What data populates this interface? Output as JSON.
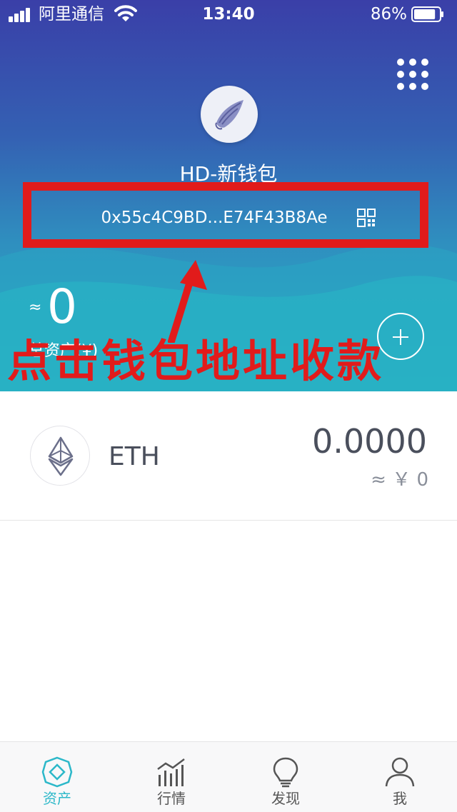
{
  "status_bar": {
    "carrier": "阿里通信",
    "time": "13:40",
    "battery": "86%",
    "battery_level": 0.86
  },
  "wallet": {
    "name": "HD-新钱包",
    "address": "0x55c4C9BD...E74F43B8Ae",
    "avatar_icon": "shell-icon"
  },
  "assets": {
    "approx_symbol": "≈",
    "total_value": "0",
    "total_label": "总资产(¥)"
  },
  "annotation": {
    "text": "点击钱包地址收款",
    "color": "#e11b1b"
  },
  "tokens": [
    {
      "symbol": "ETH",
      "balance": "0.0000",
      "fiat": "≈ ￥ 0",
      "icon": "ethereum-icon"
    }
  ],
  "tabbar": {
    "items": [
      {
        "label": "资产",
        "icon": "assets-icon",
        "active": true
      },
      {
        "label": "行情",
        "icon": "market-chart-icon",
        "active": false
      },
      {
        "label": "发现",
        "icon": "lightbulb-icon",
        "active": false
      },
      {
        "label": "我",
        "icon": "user-icon",
        "active": false
      }
    ]
  },
  "colors": {
    "header_gradient_top": "#3a3fa8",
    "header_gradient_bottom": "#29b2c4",
    "accent": "#2cb8c9",
    "annotation_red": "#e11b1b"
  }
}
